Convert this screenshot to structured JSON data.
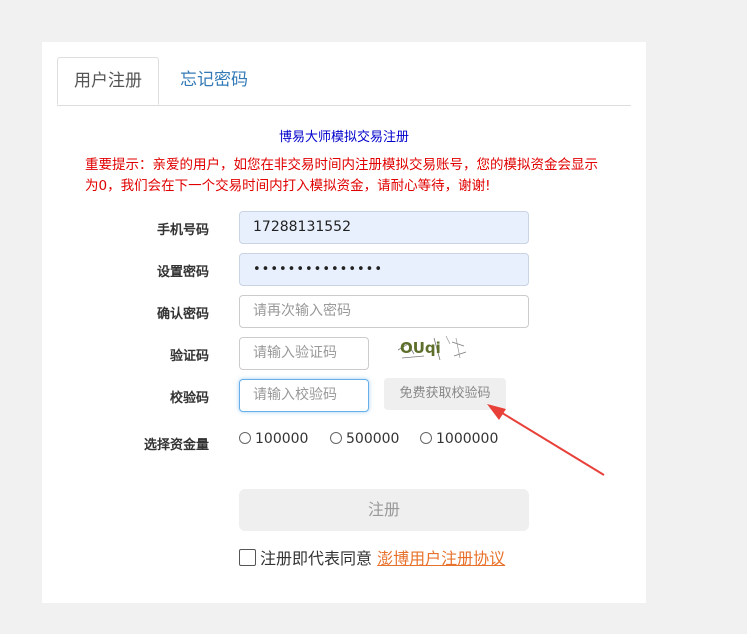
{
  "tabs": [
    {
      "label": "用户注册",
      "active": true
    },
    {
      "label": "忘记密码",
      "active": false
    }
  ],
  "headline": "博易大师模拟交易注册",
  "notice": "重要提示：亲爱的用户，如您在非交易时间内注册模拟交易账号，您的模拟资金会显示为0，我们会在下一个交易时间内打入模拟资金，请耐心等待，谢谢!",
  "form": {
    "phone": {
      "label": "手机号码",
      "value": "17288131552"
    },
    "password": {
      "label": "设置密码",
      "value": "•••••••••••••••"
    },
    "confirm": {
      "label": "确认密码",
      "placeholder": "请再次输入密码"
    },
    "captcha": {
      "label": "验证码",
      "placeholder": "请输入验证码",
      "image_text": "OUqi"
    },
    "sms": {
      "label": "校验码",
      "placeholder": "请输入校验码",
      "button": "免费获取校验码"
    },
    "fund": {
      "label": "选择资金量",
      "options": [
        "100000",
        "500000",
        "1000000"
      ]
    }
  },
  "submit_label": "注册",
  "agreement": {
    "prefix": "注册即代表同意",
    "link": "澎博用户注册协议"
  },
  "colors": {
    "notice": "#e00000",
    "headline": "#0000cc",
    "link": "#e8722c",
    "arrow": "#e8413a"
  }
}
